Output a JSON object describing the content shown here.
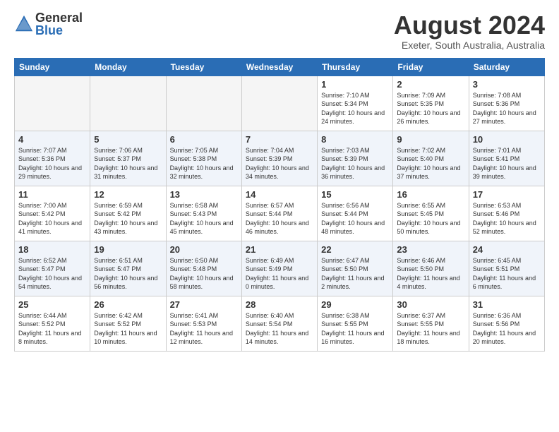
{
  "header": {
    "logo_general": "General",
    "logo_blue": "Blue",
    "month_title": "August 2024",
    "location": "Exeter, South Australia, Australia"
  },
  "weekdays": [
    "Sunday",
    "Monday",
    "Tuesday",
    "Wednesday",
    "Thursday",
    "Friday",
    "Saturday"
  ],
  "weeks": [
    [
      {
        "day": "",
        "empty": true
      },
      {
        "day": "",
        "empty": true
      },
      {
        "day": "",
        "empty": true
      },
      {
        "day": "",
        "empty": true
      },
      {
        "day": "1",
        "sunrise": "7:10 AM",
        "sunset": "5:34 PM",
        "daylight": "10 hours and 24 minutes."
      },
      {
        "day": "2",
        "sunrise": "7:09 AM",
        "sunset": "5:35 PM",
        "daylight": "10 hours and 26 minutes."
      },
      {
        "day": "3",
        "sunrise": "7:08 AM",
        "sunset": "5:36 PM",
        "daylight": "10 hours and 27 minutes."
      }
    ],
    [
      {
        "day": "4",
        "sunrise": "7:07 AM",
        "sunset": "5:36 PM",
        "daylight": "10 hours and 29 minutes."
      },
      {
        "day": "5",
        "sunrise": "7:06 AM",
        "sunset": "5:37 PM",
        "daylight": "10 hours and 31 minutes."
      },
      {
        "day": "6",
        "sunrise": "7:05 AM",
        "sunset": "5:38 PM",
        "daylight": "10 hours and 32 minutes."
      },
      {
        "day": "7",
        "sunrise": "7:04 AM",
        "sunset": "5:39 PM",
        "daylight": "10 hours and 34 minutes."
      },
      {
        "day": "8",
        "sunrise": "7:03 AM",
        "sunset": "5:39 PM",
        "daylight": "10 hours and 36 minutes."
      },
      {
        "day": "9",
        "sunrise": "7:02 AM",
        "sunset": "5:40 PM",
        "daylight": "10 hours and 37 minutes."
      },
      {
        "day": "10",
        "sunrise": "7:01 AM",
        "sunset": "5:41 PM",
        "daylight": "10 hours and 39 minutes."
      }
    ],
    [
      {
        "day": "11",
        "sunrise": "7:00 AM",
        "sunset": "5:42 PM",
        "daylight": "10 hours and 41 minutes."
      },
      {
        "day": "12",
        "sunrise": "6:59 AM",
        "sunset": "5:42 PM",
        "daylight": "10 hours and 43 minutes."
      },
      {
        "day": "13",
        "sunrise": "6:58 AM",
        "sunset": "5:43 PM",
        "daylight": "10 hours and 45 minutes."
      },
      {
        "day": "14",
        "sunrise": "6:57 AM",
        "sunset": "5:44 PM",
        "daylight": "10 hours and 46 minutes."
      },
      {
        "day": "15",
        "sunrise": "6:56 AM",
        "sunset": "5:44 PM",
        "daylight": "10 hours and 48 minutes."
      },
      {
        "day": "16",
        "sunrise": "6:55 AM",
        "sunset": "5:45 PM",
        "daylight": "10 hours and 50 minutes."
      },
      {
        "day": "17",
        "sunrise": "6:53 AM",
        "sunset": "5:46 PM",
        "daylight": "10 hours and 52 minutes."
      }
    ],
    [
      {
        "day": "18",
        "sunrise": "6:52 AM",
        "sunset": "5:47 PM",
        "daylight": "10 hours and 54 minutes."
      },
      {
        "day": "19",
        "sunrise": "6:51 AM",
        "sunset": "5:47 PM",
        "daylight": "10 hours and 56 minutes."
      },
      {
        "day": "20",
        "sunrise": "6:50 AM",
        "sunset": "5:48 PM",
        "daylight": "10 hours and 58 minutes."
      },
      {
        "day": "21",
        "sunrise": "6:49 AM",
        "sunset": "5:49 PM",
        "daylight": "11 hours and 0 minutes."
      },
      {
        "day": "22",
        "sunrise": "6:47 AM",
        "sunset": "5:50 PM",
        "daylight": "11 hours and 2 minutes."
      },
      {
        "day": "23",
        "sunrise": "6:46 AM",
        "sunset": "5:50 PM",
        "daylight": "11 hours and 4 minutes."
      },
      {
        "day": "24",
        "sunrise": "6:45 AM",
        "sunset": "5:51 PM",
        "daylight": "11 hours and 6 minutes."
      }
    ],
    [
      {
        "day": "25",
        "sunrise": "6:44 AM",
        "sunset": "5:52 PM",
        "daylight": "11 hours and 8 minutes."
      },
      {
        "day": "26",
        "sunrise": "6:42 AM",
        "sunset": "5:52 PM",
        "daylight": "11 hours and 10 minutes."
      },
      {
        "day": "27",
        "sunrise": "6:41 AM",
        "sunset": "5:53 PM",
        "daylight": "11 hours and 12 minutes."
      },
      {
        "day": "28",
        "sunrise": "6:40 AM",
        "sunset": "5:54 PM",
        "daylight": "11 hours and 14 minutes."
      },
      {
        "day": "29",
        "sunrise": "6:38 AM",
        "sunset": "5:55 PM",
        "daylight": "11 hours and 16 minutes."
      },
      {
        "day": "30",
        "sunrise": "6:37 AM",
        "sunset": "5:55 PM",
        "daylight": "11 hours and 18 minutes."
      },
      {
        "day": "31",
        "sunrise": "6:36 AM",
        "sunset": "5:56 PM",
        "daylight": "11 hours and 20 minutes."
      }
    ]
  ]
}
